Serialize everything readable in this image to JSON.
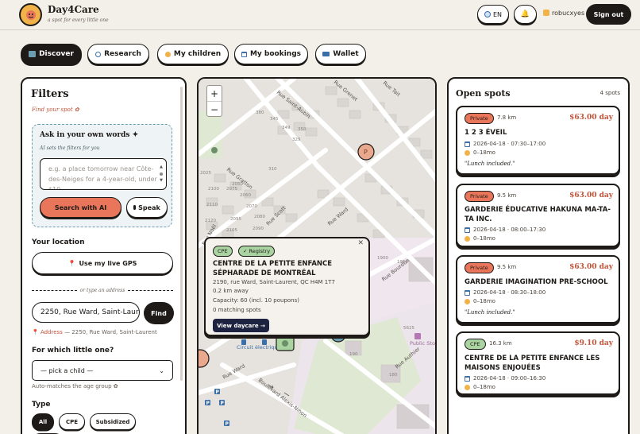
{
  "brand": {
    "name": "Day4Care",
    "tagline": "a spot for every little one"
  },
  "header": {
    "lang_label": "EN",
    "username": "robucxyes",
    "signout_label": "Sign out"
  },
  "tabs": [
    {
      "label": "Discover",
      "icon": "map-icon"
    },
    {
      "label": "Research",
      "icon": "magnifier-icon"
    },
    {
      "label": "My children",
      "icon": "baby-icon"
    },
    {
      "label": "My bookings",
      "icon": "calendar-icon"
    },
    {
      "label": "Wallet",
      "icon": "wallet-icon"
    }
  ],
  "filters": {
    "title": "Filters",
    "subtitle": "Find your spot ✿",
    "ai": {
      "title": "Ask in your own words ✦",
      "subtitle": "AI sets the filters for you",
      "placeholder": "e.g. a place tomorrow near Côte-des-Neiges for a 4-year-old, under $10...",
      "search_label": "Search with AI",
      "speak_label": "Speak"
    },
    "location_label": "Your location",
    "gps_label": "Use my live GPS",
    "or_label": "or type an address",
    "address_value": "2250, Rue Ward, Saint-Laurent",
    "find_label": "Find",
    "address_note_key": "Address",
    "address_note_value": "— 2250, Rue Ward, Saint-Laurent",
    "child_label": "For which little one?",
    "child_select": "— pick a child —",
    "auto_note": "Auto-matches the age group ✿",
    "type_label": "Type",
    "type_chips": [
      "All",
      "CPE",
      "Subsidized"
    ]
  },
  "map": {
    "zoom_in": "+",
    "zoom_out": "−",
    "street_labels": [
      "Rue Saint-Aubin",
      "Rue Tait",
      "Rue Grenet",
      "Rue Gratton",
      "Rue Scott",
      "Rue Noël",
      "Rue Ward",
      "Rue Bourdon",
      "Rue Authier",
      "Boulevard Alexis-Nihon",
      "Rue Ward",
      "Circuit électrique",
      "Public Storage"
    ],
    "building_numbers": [
      "380",
      "345",
      "349",
      "350",
      "329",
      "310",
      "2025",
      "2050",
      "2060",
      "2070",
      "2075",
      "2080",
      "2090",
      "2095",
      "2100",
      "2105",
      "2110",
      "2120",
      "1900",
      "1960",
      "5625",
      "190",
      "180"
    ],
    "popup": {
      "tags": [
        "CPE",
        "✓ Registry"
      ],
      "name": "CENTRE DE LA PETITE ENFANCE SÉPHARADE DE MONTRÉAL",
      "address": "2190, rue Ward, Saint-Laurent, QC H4M 1T7",
      "distance": "0.2 km away",
      "capacity": "Capacity: 60 (incl. 10 poupons)",
      "matching": "0 matching spots",
      "button_label": "View daycare →"
    }
  },
  "spots": {
    "title": "Open spots",
    "count": "4 spots",
    "items": [
      {
        "type": "Private",
        "distance": "7.8 km",
        "price": "$63.00 day",
        "name": "1 2 3 ÉVEIL",
        "schedule": "2026-04-18 · 07:30–17:00",
        "age": "0–18mo",
        "note": "\"Lunch included.\""
      },
      {
        "type": "Private",
        "distance": "9.5 km",
        "price": "$63.00 day",
        "name": "GARDERIE ÉDUCATIVE HAKUNA MA-TA-TA INC.",
        "schedule": "2026-04-18 · 08:00–17:30",
        "age": "0–18mo",
        "note": ""
      },
      {
        "type": "Private",
        "distance": "9.5 km",
        "price": "$63.00 day",
        "name": "GARDERIE IMAGINATION PRE-SCHOOL",
        "schedule": "2026-04-18 · 08:30–18:00",
        "age": "0–18mo",
        "note": "\"Lunch included.\""
      },
      {
        "type": "CPE",
        "distance": "16.3 km",
        "price": "$9.10 day",
        "name": "CENTRE DE LA PETITE ENFANCE LES MAISONS ENJOUÉES",
        "schedule": "2026-04-18 · 09:00–16:30",
        "age": "0–18mo",
        "note": ""
      }
    ]
  },
  "colors": {
    "accent": "#e9765a",
    "cpe_green": "#a9d3a0",
    "ink": "#1d1a17",
    "price": "#c2533a",
    "background": "#f3efe9"
  }
}
